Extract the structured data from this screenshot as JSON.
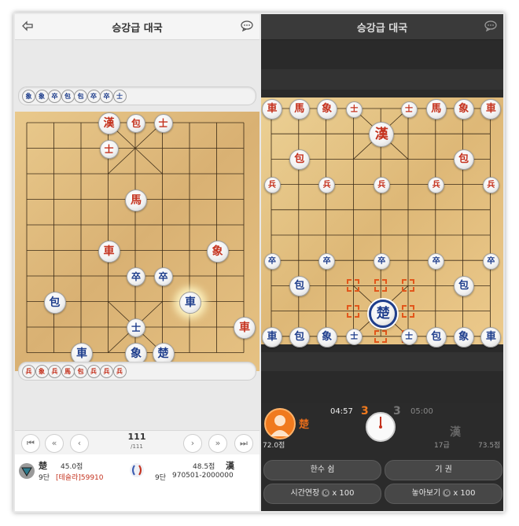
{
  "left": {
    "title": "승강급 대국",
    "captured_top": [
      "象",
      "象",
      "卒",
      "包",
      "包",
      "卒",
      "卒",
      "士"
    ],
    "captured_bottom": [
      "兵",
      "象",
      "兵",
      "馬",
      "包",
      "兵",
      "兵",
      "兵"
    ],
    "pieces": [
      {
        "c": "漢",
        "side": "red",
        "col": 3,
        "row": 0,
        "big": true
      },
      {
        "c": "包",
        "side": "red",
        "col": 4,
        "row": 0
      },
      {
        "c": "士",
        "side": "red",
        "col": 5,
        "row": 0
      },
      {
        "c": "士",
        "side": "red",
        "col": 3,
        "row": 1
      },
      {
        "c": "馬",
        "side": "red",
        "col": 4,
        "row": 3,
        "big": true
      },
      {
        "c": "車",
        "side": "red",
        "col": 3,
        "row": 5,
        "big": true
      },
      {
        "c": "象",
        "side": "red",
        "col": 7,
        "row": 5,
        "big": true
      },
      {
        "c": "卒",
        "side": "blue",
        "col": 4,
        "row": 6
      },
      {
        "c": "卒",
        "side": "blue",
        "col": 5,
        "row": 6
      },
      {
        "c": "包",
        "side": "blue",
        "col": 1,
        "row": 7,
        "big": true
      },
      {
        "c": "車",
        "side": "blue",
        "col": 6,
        "row": 7,
        "big": true,
        "glow": true
      },
      {
        "c": "士",
        "side": "blue",
        "col": 4,
        "row": 8
      },
      {
        "c": "車",
        "side": "red",
        "col": 8,
        "row": 8,
        "big": true
      },
      {
        "c": "車",
        "side": "blue",
        "col": 2,
        "row": 9,
        "big": true
      },
      {
        "c": "象",
        "side": "blue",
        "col": 4,
        "row": 9,
        "big": true
      },
      {
        "c": "楚",
        "side": "blue",
        "col": 5,
        "row": 9,
        "big": true
      }
    ],
    "nav": {
      "first": "⏮",
      "prev10": "«",
      "prev": "‹",
      "next": "›",
      "next10": "»",
      "last": "⏭"
    },
    "move_current": "111",
    "move_total": "/111",
    "player1": {
      "side_char": "楚",
      "score": "45.0점",
      "rank": "9단",
      "name": "[테슬라]59910"
    },
    "player2": {
      "side_char": "漢",
      "score": "48.5점",
      "rank": "9단",
      "name": "970501-2000000"
    }
  },
  "right": {
    "title": "승강급 대국",
    "pieces": [
      {
        "c": "車",
        "side": "red",
        "col": 0,
        "row": 0
      },
      {
        "c": "馬",
        "side": "red",
        "col": 1,
        "row": 0
      },
      {
        "c": "象",
        "side": "red",
        "col": 2,
        "row": 0
      },
      {
        "c": "士",
        "side": "red",
        "col": 3,
        "row": 0,
        "small": true
      },
      {
        "c": "士",
        "side": "red",
        "col": 5,
        "row": 0,
        "small": true
      },
      {
        "c": "馬",
        "side": "red",
        "col": 6,
        "row": 0
      },
      {
        "c": "象",
        "side": "red",
        "col": 7,
        "row": 0
      },
      {
        "c": "車",
        "side": "red",
        "col": 8,
        "row": 0
      },
      {
        "c": "漢",
        "side": "red",
        "col": 4,
        "row": 1,
        "big": true
      },
      {
        "c": "包",
        "side": "red",
        "col": 1,
        "row": 2
      },
      {
        "c": "包",
        "side": "red",
        "col": 7,
        "row": 2
      },
      {
        "c": "兵",
        "side": "red",
        "col": 0,
        "row": 3,
        "small": true
      },
      {
        "c": "兵",
        "side": "red",
        "col": 2,
        "row": 3,
        "small": true
      },
      {
        "c": "兵",
        "side": "red",
        "col": 4,
        "row": 3,
        "small": true
      },
      {
        "c": "兵",
        "side": "red",
        "col": 6,
        "row": 3,
        "small": true
      },
      {
        "c": "兵",
        "side": "red",
        "col": 8,
        "row": 3,
        "small": true
      },
      {
        "c": "卒",
        "side": "blue",
        "col": 0,
        "row": 6,
        "small": true
      },
      {
        "c": "卒",
        "side": "blue",
        "col": 2,
        "row": 6,
        "small": true
      },
      {
        "c": "卒",
        "side": "blue",
        "col": 4,
        "row": 6,
        "small": true
      },
      {
        "c": "卒",
        "side": "blue",
        "col": 6,
        "row": 6,
        "small": true
      },
      {
        "c": "卒",
        "side": "blue",
        "col": 8,
        "row": 6,
        "small": true
      },
      {
        "c": "包",
        "side": "blue",
        "col": 1,
        "row": 7
      },
      {
        "c": "包",
        "side": "blue",
        "col": 7,
        "row": 7
      },
      {
        "c": "楚",
        "side": "blue",
        "col": 4,
        "row": 8,
        "big": true,
        "selected": true
      },
      {
        "c": "車",
        "side": "blue",
        "col": 0,
        "row": 9
      },
      {
        "c": "包",
        "side": "blue",
        "col": 1,
        "row": 9
      },
      {
        "c": "象",
        "side": "blue",
        "col": 2,
        "row": 9
      },
      {
        "c": "士",
        "side": "blue",
        "col": 3,
        "row": 9,
        "small": true
      },
      {
        "c": "士",
        "side": "blue",
        "col": 5,
        "row": 9,
        "small": true
      },
      {
        "c": "包",
        "side": "blue",
        "col": 6,
        "row": 9
      },
      {
        "c": "象",
        "side": "blue",
        "col": 7,
        "row": 9
      },
      {
        "c": "車",
        "side": "blue",
        "col": 8,
        "row": 9
      }
    ],
    "targets": [
      [
        3,
        7
      ],
      [
        4,
        7
      ],
      [
        5,
        7
      ],
      [
        3,
        8
      ],
      [
        5,
        8
      ],
      [
        4,
        9
      ],
      [
        5,
        9
      ]
    ],
    "my_time": "04:57",
    "my_count": "3",
    "opp_count": "3",
    "opp_time": "05:00",
    "my_side": "楚",
    "my_score": "72.0점",
    "opp_side": "漢",
    "opp_rank": "17급",
    "opp_score": "73.5점",
    "btn_pass": "한수 쉼",
    "btn_resign": "기 권",
    "btn_extend": "시간연장",
    "btn_extend_cost": "x 100",
    "btn_placement": "놓아보기",
    "btn_placement_cost": "x 100",
    "coin_letter": "G"
  }
}
